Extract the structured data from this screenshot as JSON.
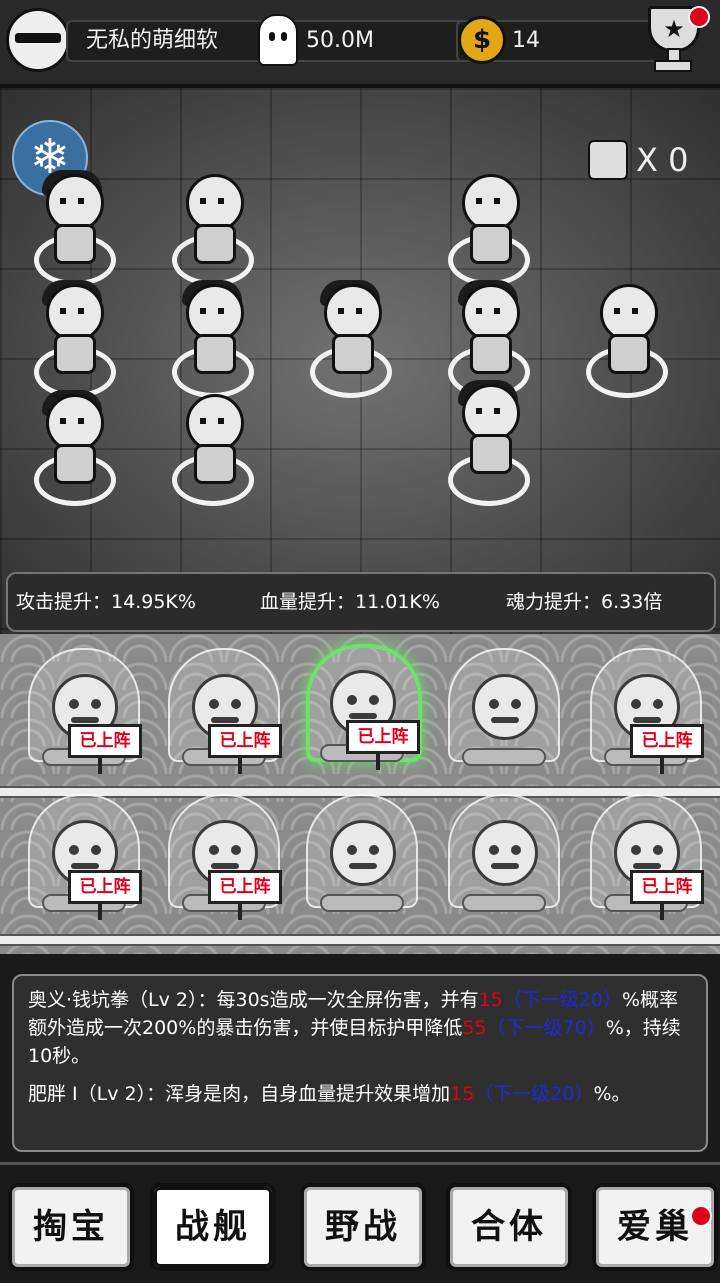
{
  "header": {
    "player_name": "无私的萌细软",
    "souls": "50.0M",
    "coins": "14",
    "coin_symbol": "$",
    "trophy_symbol": "★"
  },
  "battle": {
    "buff_icon": "❄",
    "dice_count": "X 0",
    "stats": [
      {
        "label": "攻击提升：",
        "value": "14.95K%"
      },
      {
        "label": "血量提升：",
        "value": "11.01K%"
      },
      {
        "label": "魂力提升：",
        "value": "6.33倍"
      }
    ]
  },
  "collection": {
    "sign_text": "已上阵"
  },
  "description": {
    "skill1": {
      "a": "奥义·钱坑拳（Lv 2）：每30s造成一次全屏伤害，并有",
      "v1": "15",
      "n1": "（下一级20）",
      "b": "%概率额外造成一次200%的暴击伤害，并使目标护甲降低",
      "v2": "55",
      "n2": "（下一级70）",
      "c": "%，持续10秒。"
    },
    "skill2": {
      "a": "肥胖 I（Lv 2）：浑身是肉，自身血量提升效果增加",
      "v1": "15",
      "n1": "（下一级20）",
      "c": "%。"
    }
  },
  "nav": {
    "items": [
      "掏宝",
      "战舰",
      "野战",
      "合体",
      "爱巢"
    ],
    "active": "战舰"
  },
  "colors": {
    "accent_green": "#6fe06a",
    "alert_red": "#e0001b",
    "next_blue": "#1c2bd6",
    "coin_gold": "#e2a617"
  }
}
